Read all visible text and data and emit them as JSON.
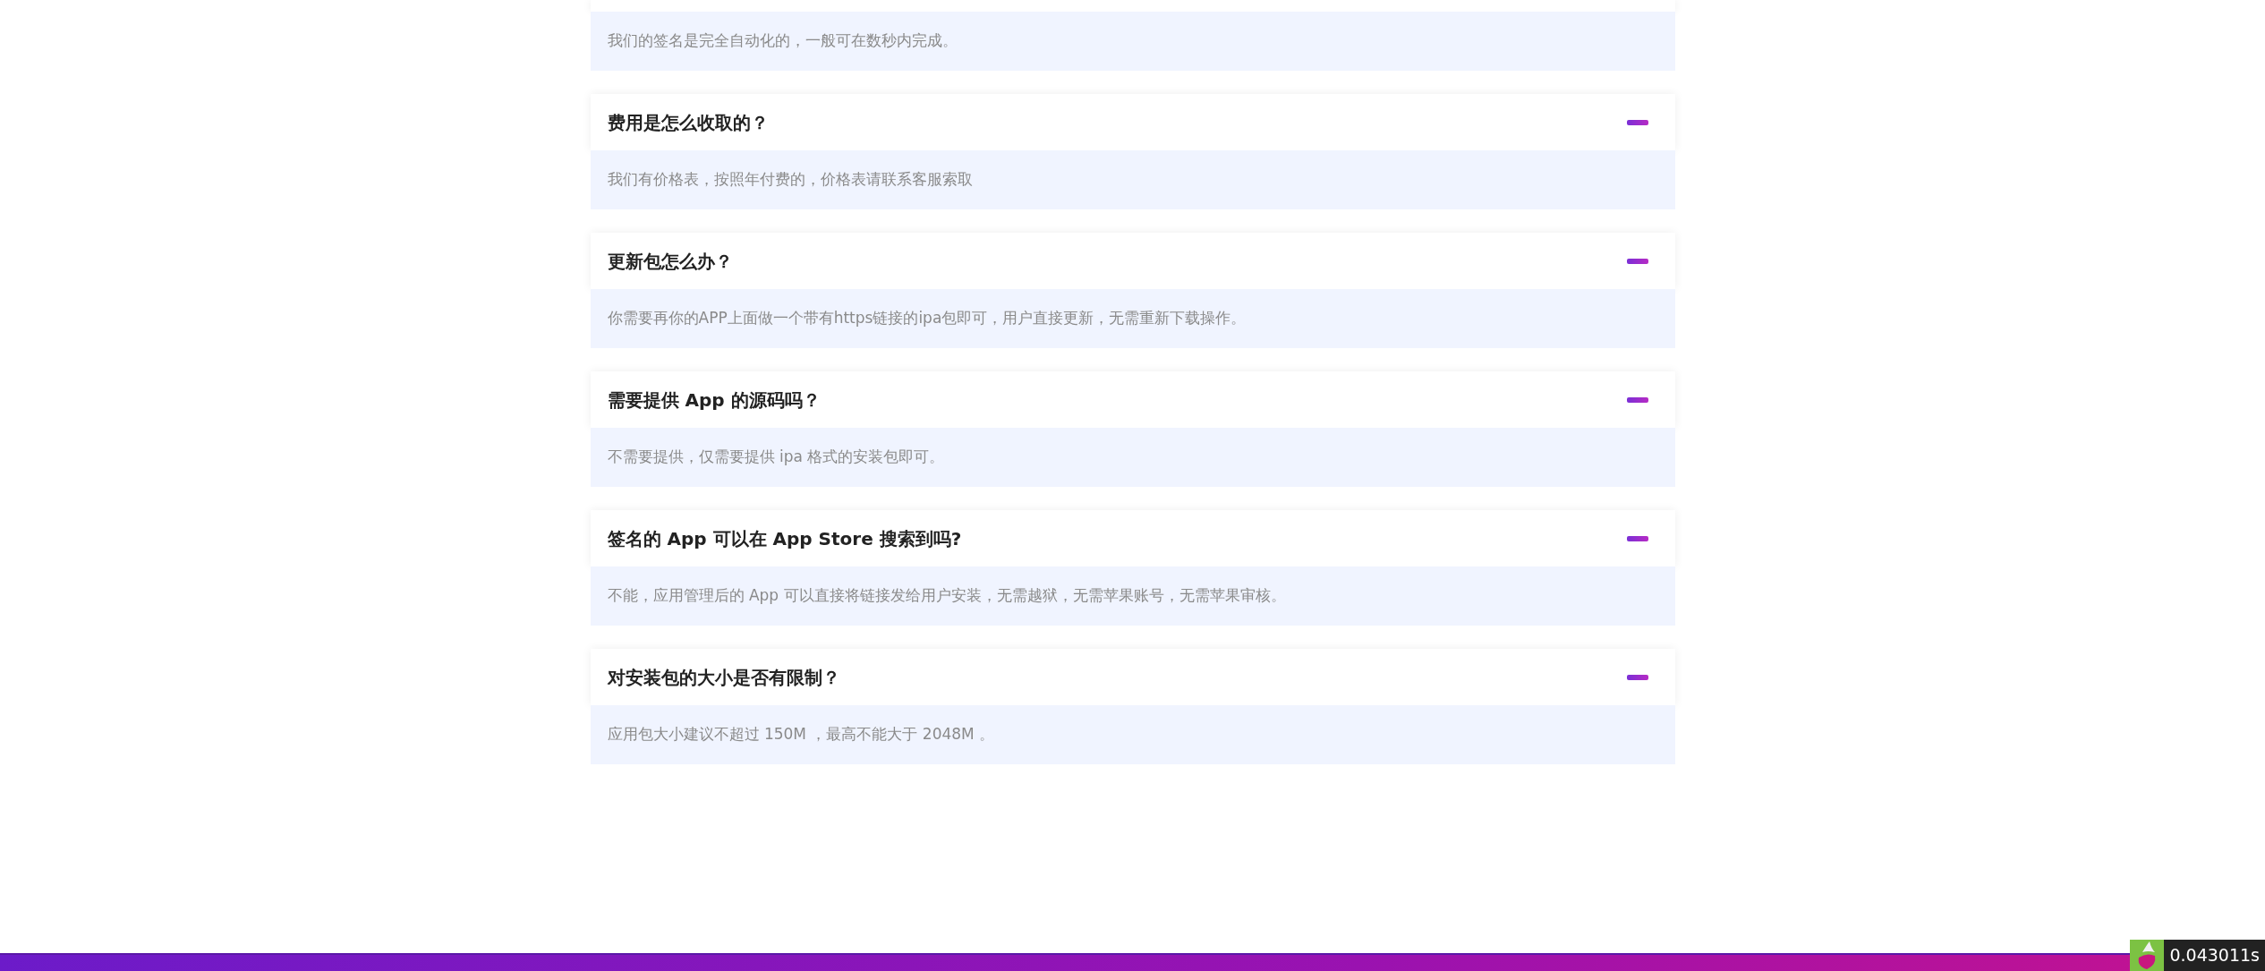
{
  "faq": [
    {
      "answer": "我们的签名是完全自动化的，一般可在数秒内完成。",
      "expanded": true
    },
    {
      "question": "费用是怎么收取的？",
      "answer": "我们有价格表，按照年付费的，价格表请联系客服索取",
      "expanded": true
    },
    {
      "question": "更新包怎么办？",
      "answer": "你需要再你的APP上面做一个带有https链接的ipa包即可，用户直接更新，无需重新下载操作。",
      "expanded": true
    },
    {
      "question": "需要提供 App 的源码吗？",
      "answer": "不需要提供，仅需要提供 ipa 格式的安装包即可。",
      "expanded": true
    },
    {
      "question": "签名的 App 可以在 App Store 搜索到吗?",
      "answer": "不能，应用管理后的 App 可以直接将链接发给用户安装，无需越狱，无需苹果账号，无需苹果审核。",
      "expanded": true
    },
    {
      "question": "对安装包的大小是否有限制？",
      "answer": "应用包大小建议不超过 150M ，最高不能大于 2048M 。",
      "expanded": true
    }
  ],
  "debug_timer": "0.043011s"
}
